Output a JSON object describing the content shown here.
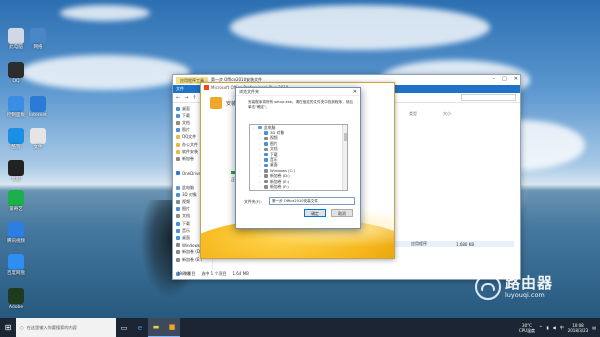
{
  "desktop": {
    "icons": [
      {
        "label": "此电脑",
        "icon": "computer-icon",
        "color": "#cfd8e3"
      },
      {
        "label": "网络",
        "icon": "network-icon",
        "color": "#4a86c7"
      },
      {
        "label": "QQ",
        "icon": "qq-icon",
        "color": "#2d2d2d"
      },
      {
        "label": "控制面板",
        "icon": "control-panel-icon",
        "color": "#3a8ee6"
      },
      {
        "label": "Internet",
        "icon": "ie-icon",
        "color": "#2a7bd6"
      },
      {
        "label": "酷狗",
        "icon": "kugou-icon",
        "color": "#1a8fe3"
      },
      {
        "label": "文件",
        "icon": "file-icon",
        "color": "#e5e5e5"
      },
      {
        "label": "优酷",
        "icon": "youku-icon",
        "color": "#222222"
      },
      {
        "label": "爱奇艺",
        "icon": "iqiyi-icon",
        "color": "#1cb04b"
      },
      {
        "label": "腾讯视频",
        "icon": "tencent-video-icon",
        "color": "#2b7fe3"
      },
      {
        "label": "百度网盘",
        "icon": "baidu-netdisk-icon",
        "color": "#2f8ef2"
      },
      {
        "label": "Adobe",
        "icon": "adobe-icon",
        "color": "#1f3b1f"
      }
    ]
  },
  "explorer": {
    "tab_label": "应用程序工具",
    "title": "第一步 Office2010安装文件",
    "file_menu": "文件",
    "sidebar": [
      {
        "label": "桌面",
        "color": "#4a90d9"
      },
      {
        "label": "下载",
        "color": "#4a90d9"
      },
      {
        "label": "文档",
        "color": "#8a8a8a"
      },
      {
        "label": "图片",
        "color": "#4a90d9"
      },
      {
        "label": "QQ文件",
        "color": "#e8b93e"
      },
      {
        "label": "办公文件",
        "color": "#e8b93e"
      },
      {
        "label": "软件安装",
        "color": "#e8b93e"
      },
      {
        "label": "新加卷",
        "color": "#8a8a8a"
      },
      {
        "label": "",
        "color": "#ffffff"
      },
      {
        "label": "OneDrive",
        "color": "#2b7bd6"
      },
      {
        "label": "",
        "color": "#ffffff"
      },
      {
        "label": "此电脑",
        "color": "#5c9ad8"
      },
      {
        "label": "3D 对象",
        "color": "#4a90d9"
      },
      {
        "label": "视频",
        "color": "#8a8a8a"
      },
      {
        "label": "图片",
        "color": "#4a90d9"
      },
      {
        "label": "文档",
        "color": "#8a8a8a"
      },
      {
        "label": "下载",
        "color": "#4a90d9"
      },
      {
        "label": "音乐",
        "color": "#4a90d9"
      },
      {
        "label": "桌面",
        "color": "#4a90d9"
      },
      {
        "label": "Windows (C:)",
        "color": "#8a8a8a"
      },
      {
        "label": "新加卷 (D:)",
        "color": "#8a8a8a"
      },
      {
        "label": "新加卷 (E:)",
        "color": "#8a8a8a"
      },
      {
        "label": "",
        "color": "#ffffff"
      },
      {
        "label": "网络",
        "color": "#5c9ad8"
      }
    ],
    "status_items": "19 个项目",
    "status_selected": "选中 1 个项目",
    "status_size": "1.64 MB",
    "columns": [
      "类型",
      "大小"
    ],
    "selected_row": {
      "name": "安装数据",
      "date": "2018/4/18 17:17",
      "type": "应用程序",
      "size": "1,680 KB"
    }
  },
  "installer": {
    "title": "Microsoft Office Professional Plus 2010",
    "heading": "安装",
    "progress_text": "正在...",
    "progress": 0.1
  },
  "dialog": {
    "title": "浏览文件夹",
    "message": "安装程序将所有 setup.exe。请在指定的文件夹中找到程序，然后单击\"确定\"。",
    "tree": [
      {
        "label": "此电脑",
        "indent": 0,
        "color": "#5c9ad8"
      },
      {
        "label": "3D 对象",
        "indent": 1,
        "color": "#4a90d9"
      },
      {
        "label": "视频",
        "indent": 1,
        "color": "#8a8a8a"
      },
      {
        "label": "图片",
        "indent": 1,
        "color": "#4a90d9"
      },
      {
        "label": "文档",
        "indent": 1,
        "color": "#8a8a8a"
      },
      {
        "label": "下载",
        "indent": 1,
        "color": "#4a90d9"
      },
      {
        "label": "音乐",
        "indent": 1,
        "color": "#4a90d9"
      },
      {
        "label": "桌面",
        "indent": 1,
        "color": "#4a90d9"
      },
      {
        "label": "Windows (C:)",
        "indent": 1,
        "color": "#8a8a8a"
      },
      {
        "label": "新加卷 (D:)",
        "indent": 1,
        "color": "#8a8a8a"
      },
      {
        "label": "新加卷 (E:)",
        "indent": 1,
        "color": "#8a8a8a"
      },
      {
        "label": "新加卷 (F:)",
        "indent": 1,
        "color": "#8a8a8a"
      }
    ],
    "folder_label": "文件夹(F):",
    "folder_value": "第一步 Office2010安装文件",
    "ok_label": "确定",
    "cancel_label": "取消"
  },
  "taskbar": {
    "search_placeholder": "在这里输入你要搜索的内容",
    "temp": "30°C",
    "weather": "CPU温度",
    "time": "10:08",
    "date": "2018/3/23"
  },
  "watermark": {
    "cn": "路由器",
    "en": "luyouqi.com"
  }
}
